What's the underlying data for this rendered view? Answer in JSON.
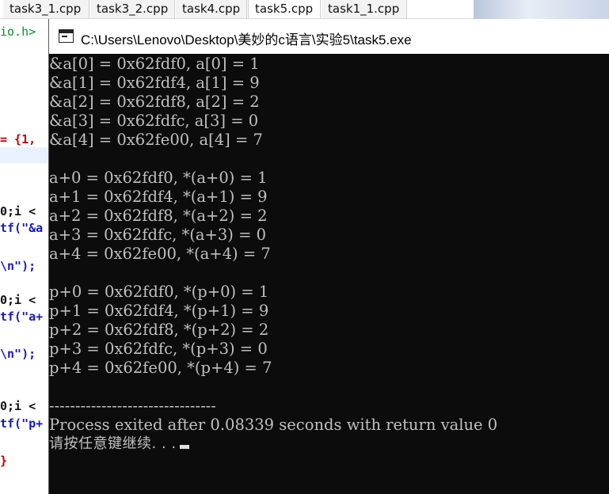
{
  "ide": {
    "tabs": [
      {
        "label": "task3_1.cpp",
        "active": false
      },
      {
        "label": "task3_2.cpp",
        "active": false
      },
      {
        "label": "task4.cpp",
        "active": false
      },
      {
        "label": "task5.cpp",
        "active": true
      },
      {
        "label": "task1_1.cpp",
        "active": false
      }
    ],
    "code_fragments": {
      "include_tail": "io.h>",
      "array_init": "= {1,",
      "loop1": "0;i <",
      "printf1": "tf(\"&a",
      "newline1": "\\n\");",
      "loop2": "0;i <",
      "printf2": "tf(\"a+",
      "newline2": "\\n\");",
      "loop3": "0;i <",
      "printf3": "tf(\"p+",
      "brace": "}"
    }
  },
  "console": {
    "title": "C:\\Users\\Lenovo\\Desktop\\美妙的c语言\\实验5\\task5.exe",
    "lines": [
      "&a[0] = 0x62fdf0, a[0] = 1",
      "&a[1] = 0x62fdf4, a[1] = 9",
      "&a[2] = 0x62fdf8, a[2] = 2",
      "&a[3] = 0x62fdfc, a[3] = 0",
      "&a[4] = 0x62fe00, a[4] = 7",
      "",
      "a+0 = 0x62fdf0, *(a+0) = 1",
      "a+1 = 0x62fdf4, *(a+1) = 9",
      "a+2 = 0x62fdf8, *(a+2) = 2",
      "a+3 = 0x62fdfc, *(a+3) = 0",
      "a+4 = 0x62fe00, *(a+4) = 7",
      "",
      "p+0 = 0x62fdf0, *(p+0) = 1",
      "p+1 = 0x62fdf4, *(p+1) = 9",
      "p+2 = 0x62fdf8, *(p+2) = 2",
      "p+3 = 0x62fdfc, *(p+3) = 0",
      "p+4 = 0x62fe00, *(p+4) = 7",
      "",
      "--------------------------------",
      "Process exited after 0.08339 seconds with return value 0"
    ],
    "prompt": "请按任意键继续. . ."
  }
}
